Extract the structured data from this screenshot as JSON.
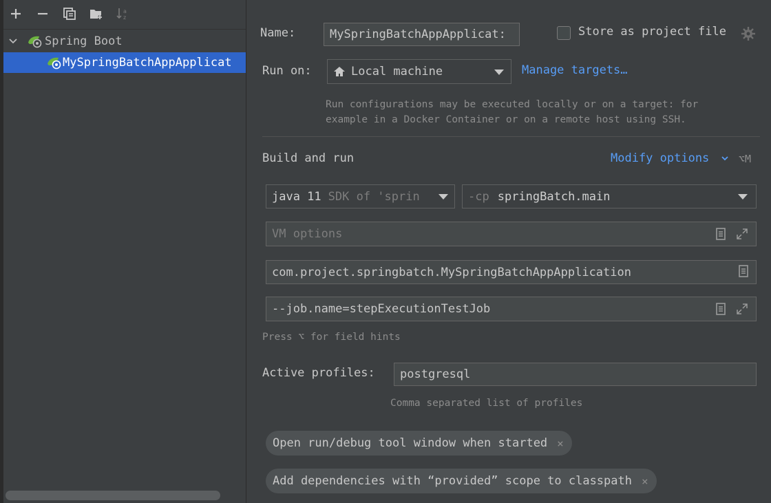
{
  "toolbar": {
    "add_icon": "plus-icon",
    "remove_icon": "minus-icon",
    "copy_icon": "copy-icon",
    "folder_icon": "new-folder-icon",
    "sort_icon": "sort-az-icon"
  },
  "tree": {
    "group_label": "Spring Boot",
    "item_label": "MySpringBatchAppApplicat"
  },
  "form": {
    "name_label": "Name:",
    "name_value": "MySpringBatchAppApplicat:",
    "store_label": "Store as project file",
    "run_on_label": "Run on:",
    "run_on_value": "Local machine",
    "manage_targets": "Manage targets…",
    "run_hint_line1": "Run configurations may be executed locally or on a target: for",
    "run_hint_line2": "example in a Docker Container or on a remote host using SSH.",
    "build_and_run": "Build and run",
    "modify_options": "Modify options",
    "modify_shortcut": "⌥M",
    "sdk_main": "java 11",
    "sdk_sub": "SDK of 'sprin",
    "cp_prefix": "-cp",
    "cp_value": "springBatch.main",
    "vm_placeholder": "VM options",
    "main_class": "com.project.springbatch.MySpringBatchAppApplication",
    "program_args": "--job.name=stepExecutionTestJob",
    "field_hint": "Press ⌥ for field hints",
    "active_profiles_label": "Active profiles:",
    "active_profiles_value": "postgresql",
    "profiles_hint": "Comma separated list of profiles",
    "chip1": "Open run/debug tool window when started",
    "chip2": "Add dependencies with “provided” scope to classpath",
    "chip_close": "×"
  },
  "colors": {
    "background": "#3c3f41",
    "selection": "#2f65ca",
    "link": "#589df6",
    "spring_green": "#6db33f"
  }
}
